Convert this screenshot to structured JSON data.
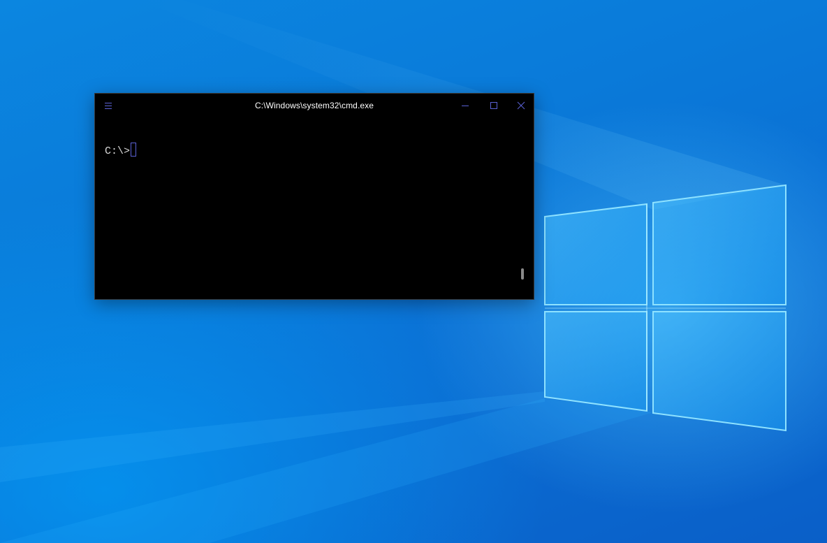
{
  "window": {
    "title": "C:\\Windows\\system32\\cmd.exe",
    "menu_icon": "hamburger-menu-icon",
    "controls": {
      "minimize_icon": "minimize-icon",
      "maximize_icon": "maximize-icon",
      "close_icon": "close-icon"
    }
  },
  "console": {
    "prompt": "C:\\>",
    "input": ""
  },
  "colors": {
    "desktop_blue": "#0a7ad9",
    "console_bg": "#000000",
    "accent": "#5b62d6",
    "text": "#d9d9d9"
  }
}
